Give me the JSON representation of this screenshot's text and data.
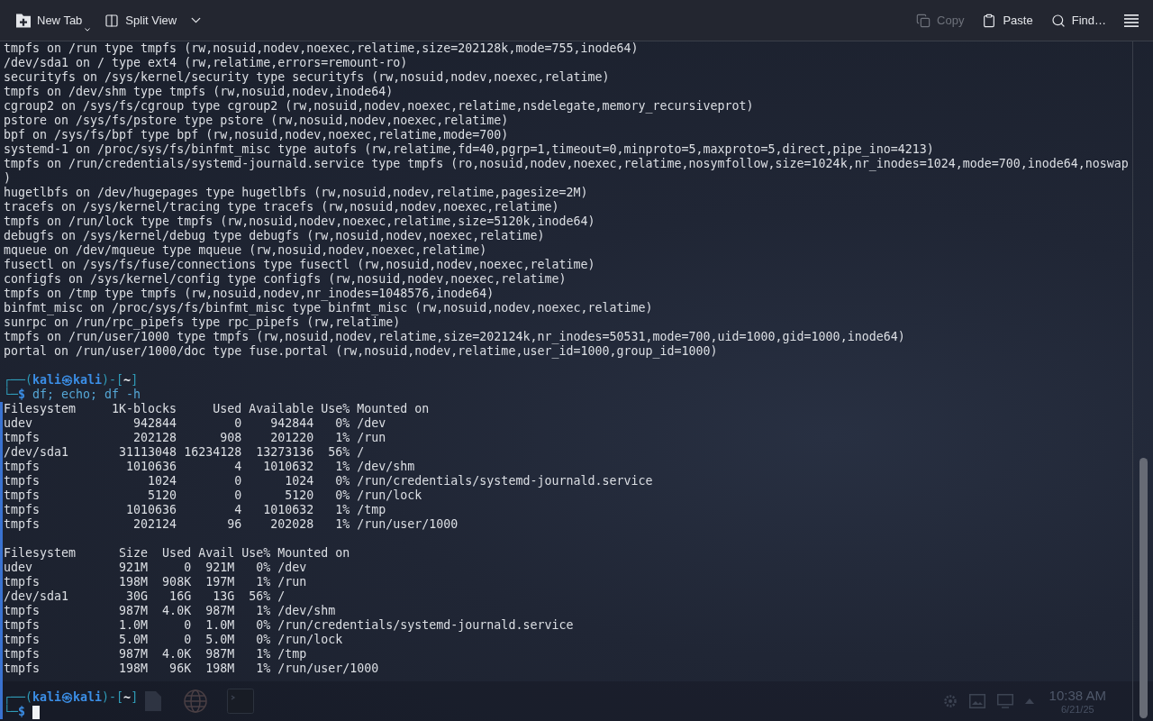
{
  "toolbar": {
    "left": [
      {
        "kind": "new_tab",
        "label": "New Tab"
      },
      {
        "kind": "split_view",
        "label": "Split View"
      }
    ],
    "right": [
      {
        "kind": "copy",
        "label": "Copy",
        "disabled": true
      },
      {
        "kind": "paste",
        "label": "Paste",
        "disabled": false
      },
      {
        "kind": "find",
        "label": "Find…",
        "disabled": false
      },
      {
        "kind": "menu",
        "disabled": false
      }
    ]
  },
  "terminal": {
    "blocks": [
      {
        "kind": "output",
        "marked": false,
        "lines": [
          "tmpfs on /run type tmpfs (rw,nosuid,nodev,noexec,relatime,size=202128k,mode=755,inode64)",
          "/dev/sda1 on / type ext4 (rw,relatime,errors=remount-ro)",
          "securityfs on /sys/kernel/security type securityfs (rw,nosuid,nodev,noexec,relatime)",
          "tmpfs on /dev/shm type tmpfs (rw,nosuid,nodev,inode64)",
          "cgroup2 on /sys/fs/cgroup type cgroup2 (rw,nosuid,nodev,noexec,relatime,nsdelegate,memory_recursiveprot)",
          "pstore on /sys/fs/pstore type pstore (rw,nosuid,nodev,noexec,relatime)",
          "bpf on /sys/fs/bpf type bpf (rw,nosuid,nodev,noexec,relatime,mode=700)",
          "systemd-1 on /proc/sys/fs/binfmt_misc type autofs (rw,relatime,fd=40,pgrp=1,timeout=0,minproto=5,maxproto=5,direct,pipe_ino=4213)",
          "tmpfs on /run/credentials/systemd-journald.service type tmpfs (ro,nosuid,nodev,noexec,relatime,nosymfollow,size=1024k,nr_inodes=1024,mode=700,inode64,noswap",
          ")",
          "hugetlbfs on /dev/hugepages type hugetlbfs (rw,nosuid,nodev,relatime,pagesize=2M)",
          "tracefs on /sys/kernel/tracing type tracefs (rw,nosuid,nodev,noexec,relatime)",
          "tmpfs on /run/lock type tmpfs (rw,nosuid,nodev,noexec,relatime,size=5120k,inode64)",
          "debugfs on /sys/kernel/debug type debugfs (rw,nosuid,nodev,noexec,relatime)",
          "mqueue on /dev/mqueue type mqueue (rw,nosuid,nodev,noexec,relatime)",
          "fusectl on /sys/fs/fuse/connections type fusectl (rw,nosuid,nodev,noexec,relatime)",
          "configfs on /sys/kernel/config type configfs (rw,nosuid,nodev,noexec,relatime)",
          "tmpfs on /tmp type tmpfs (rw,nosuid,nodev,nr_inodes=1048576,inode64)",
          "binfmt_misc on /proc/sys/fs/binfmt_misc type binfmt_misc (rw,nosuid,nodev,noexec,relatime)",
          "sunrpc on /run/rpc_pipefs type rpc_pipefs (rw,relatime)",
          "tmpfs on /run/user/1000 type tmpfs (rw,nosuid,nodev,relatime,size=202124k,nr_inodes=50531,mode=700,uid=1000,gid=1000,inode64)",
          "portal on /run/user/1000/doc type fuse.portal (rw,nosuid,nodev,relatime,user_id=1000,group_id=1000)"
        ]
      },
      {
        "kind": "prompt",
        "marked": false,
        "cursor": false,
        "top": [
          {
            "kind": "frame",
            "text": "┌──("
          },
          {
            "kind": "user",
            "text": "kali㉿kali"
          },
          {
            "kind": "frame",
            "text": ")-["
          },
          {
            "kind": "cwd",
            "text": "~"
          },
          {
            "kind": "frame",
            "text": "]"
          }
        ],
        "bottom": [
          {
            "kind": "frame",
            "text": "└─"
          },
          {
            "kind": "user",
            "text": "$"
          },
          {
            "kind": "command",
            "text": " df; echo; df -h"
          }
        ]
      },
      {
        "kind": "output",
        "marked": true,
        "lines": [
          "Filesystem     1K-blocks     Used Available Use% Mounted on",
          "udev              942844        0    942844   0% /dev",
          "tmpfs             202128      908    201220   1% /run",
          "/dev/sda1       31113048 16234128  13273136  56% /",
          "tmpfs            1010636        4   1010632   1% /dev/shm",
          "tmpfs               1024        0      1024   0% /run/credentials/systemd-journald.service",
          "tmpfs               5120        0      5120   0% /run/lock",
          "tmpfs            1010636        4   1010632   1% /tmp",
          "tmpfs             202124       96    202028   1% /run/user/1000"
        ]
      },
      {
        "kind": "output",
        "marked": true,
        "lines": [
          "Filesystem      Size  Used Avail Use% Mounted on",
          "udev            921M     0  921M   0% /dev",
          "tmpfs           198M  908K  197M   1% /run",
          "/dev/sda1        30G   16G   13G  56% /",
          "tmpfs           987M  4.0K  987M   1% /dev/shm",
          "tmpfs           1.0M     0  1.0M   0% /run/credentials/systemd-journald.service",
          "tmpfs           5.0M     0  5.0M   0% /run/lock",
          "tmpfs           987M  4.0K  987M   1% /tmp",
          "tmpfs           198M   96K  198M   1% /run/user/1000"
        ]
      },
      {
        "kind": "prompt",
        "marked": true,
        "cursor": true,
        "top": [
          {
            "kind": "frame",
            "text": "┌──("
          },
          {
            "kind": "user",
            "text": "kali㉿kali"
          },
          {
            "kind": "frame",
            "text": ")-["
          },
          {
            "kind": "cwd",
            "text": "~"
          },
          {
            "kind": "frame",
            "text": "]"
          }
        ],
        "bottom": [
          {
            "kind": "frame",
            "text": "└─"
          },
          {
            "kind": "user",
            "text": "$"
          }
        ]
      }
    ]
  },
  "taskbar": {
    "time": "10:38 AM",
    "date": "6/21/25"
  }
}
